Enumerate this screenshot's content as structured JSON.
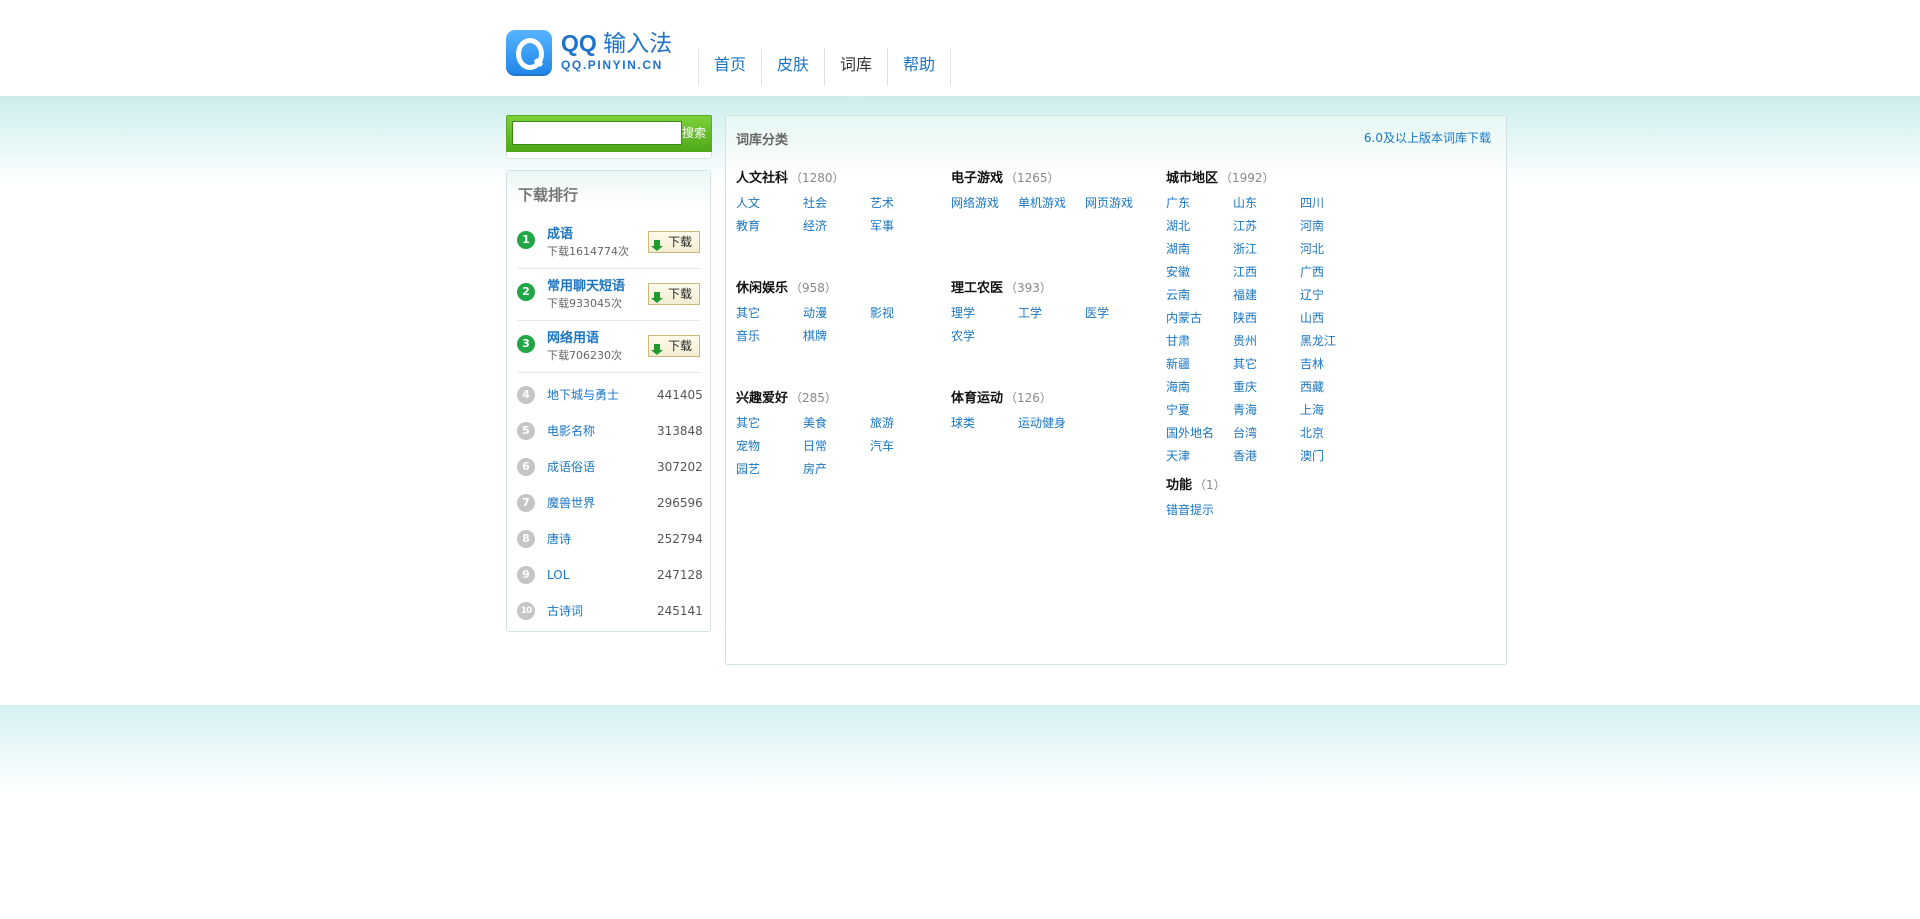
{
  "header": {
    "logo_main": "QQ",
    "logo_cn": "输入法",
    "logo_sub": "QQ.PINYIN.CN",
    "nav": [
      "首页",
      "皮肤",
      "词库",
      "帮助"
    ]
  },
  "search": {
    "button": "搜索",
    "value": ""
  },
  "ranking": {
    "title": "下载排行",
    "download_label": "下载",
    "top": [
      {
        "rank": "1",
        "name": "成语",
        "count": "下载1614774次"
      },
      {
        "rank": "2",
        "name": "常用聊天短语",
        "count": "下载933045次"
      },
      {
        "rank": "3",
        "name": "网络用语",
        "count": "下载706230次"
      }
    ],
    "rest": [
      {
        "rank": "4",
        "name": "地下城与勇士",
        "count": "441405"
      },
      {
        "rank": "5",
        "name": "电影名称",
        "count": "313848"
      },
      {
        "rank": "6",
        "name": "成语俗语",
        "count": "307202"
      },
      {
        "rank": "7",
        "name": "魔兽世界",
        "count": "296596"
      },
      {
        "rank": "8",
        "name": "唐诗",
        "count": "252794"
      },
      {
        "rank": "9",
        "name": "LOL",
        "count": "247128"
      },
      {
        "rank": "10",
        "name": "古诗词",
        "count": "245141"
      }
    ]
  },
  "main": {
    "title": "词库分类",
    "link": "6.0及以上版本词库下载",
    "categories": [
      {
        "name": "人文社科",
        "count": "（1280）",
        "items": [
          "人文",
          "社会",
          "艺术",
          "教育",
          "经济",
          "军事"
        ]
      },
      {
        "name": "电子游戏",
        "count": "（1265）",
        "items": [
          "网络游戏",
          "单机游戏",
          "网页游戏"
        ]
      },
      {
        "name": "城市地区",
        "count": "（1992）",
        "items": [
          "广东",
          "山东",
          "四川",
          "湖北",
          "江苏",
          "河南",
          "湖南",
          "浙江",
          "河北",
          "安徽",
          "江西",
          "广西",
          "云南",
          "福建",
          "辽宁",
          "内蒙古",
          "陕西",
          "山西",
          "甘肃",
          "贵州",
          "黑龙江",
          "新疆",
          "其它",
          "吉林",
          "海南",
          "重庆",
          "西藏",
          "宁夏",
          "青海",
          "上海",
          "国外地名",
          "台湾",
          "北京",
          "天津",
          "香港",
          "澳门"
        ]
      },
      {
        "name": "休闲娱乐",
        "count": "（958）",
        "items": [
          "其它",
          "动漫",
          "影视",
          "音乐",
          "棋牌"
        ]
      },
      {
        "name": "理工农医",
        "count": "（393）",
        "items": [
          "理学",
          "工学",
          "医学",
          "农学"
        ]
      },
      {
        "name": "兴趣爱好",
        "count": "（285）",
        "items": [
          "其它",
          "美食",
          "旅游",
          "宠物",
          "日常",
          "汽车",
          "园艺",
          "房产"
        ]
      },
      {
        "name": "体育运动",
        "count": "（126）",
        "items": [
          "球类",
          "运动健身"
        ]
      },
      {
        "name": "功能",
        "count": "（1）",
        "items": [
          "错音提示"
        ]
      }
    ]
  }
}
